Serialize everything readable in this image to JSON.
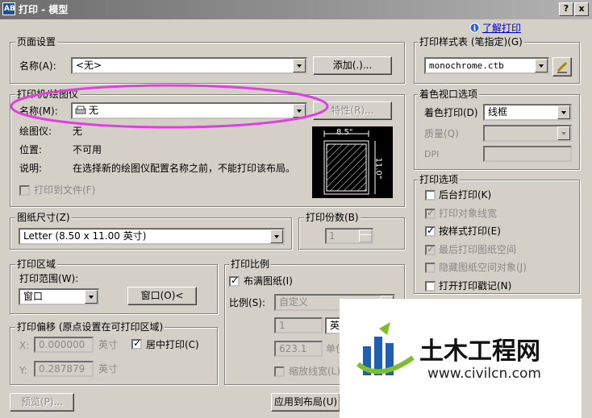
{
  "window": {
    "title": "打印 - 模型",
    "app_icon_text": "AB",
    "help_btn": "?",
    "close_btn": "x",
    "learn_link": "了解打印"
  },
  "page_setup": {
    "legend": "页面设置",
    "name_label": "名称(A):",
    "name_value": "<无>",
    "add_button": "添加(.)..."
  },
  "plotter": {
    "legend": "打印机/绘图仪",
    "name_label": "名称(M):",
    "name_value": "无",
    "properties_button": "特性(R)...",
    "plotter_label": "绘图仪:",
    "plotter_value": "无",
    "location_label": "位置:",
    "location_value": "不可用",
    "description_label": "说明:",
    "description_value": "在选择新的绘图仪配置名称之前，不能打印该布局。",
    "print_to_file": "打印到文件(F)",
    "preview_width": "8.5\"",
    "preview_height": "11.0\""
  },
  "paper_size": {
    "legend": "图纸尺寸(Z)",
    "value": "Letter (8.50 x 11.00 英寸)"
  },
  "copies": {
    "legend": "打印份数(B)",
    "value": "1"
  },
  "plot_area": {
    "legend": "打印区域",
    "range_label": "打印范围(W):",
    "range_value": "窗口",
    "window_button": "窗口(O)<"
  },
  "plot_offset": {
    "legend": "打印偏移 (原点设置在可打印区域)",
    "x_label": "X:",
    "x_value": "0.000000",
    "x_unit": "英寸",
    "y_label": "Y:",
    "y_value": "0.287879",
    "y_unit": "英寸",
    "center": "居中打印(C)"
  },
  "plot_scale": {
    "legend": "打印比例",
    "fit": "布满图纸(I)",
    "scale_label": "比例(S):",
    "scale_value": "自定义",
    "value1": "1",
    "unit1": "英寸",
    "value2": "623.1",
    "unit2": "单位",
    "scale_lineweights": "缩放线宽(L)"
  },
  "buttons": {
    "preview": "预览(P)...",
    "apply": "应用到布局(U)"
  },
  "style_table": {
    "legend": "打印样式表 (笔指定)(G)",
    "value": "monochrome.ctb"
  },
  "shaded": {
    "legend": "着色视口选项",
    "shade_label": "着色打印(D)",
    "shade_value": "线框",
    "quality_label": "质量(Q)",
    "dpi_label": "DPI"
  },
  "options": {
    "legend": "打印选项",
    "items": [
      {
        "label": "后台打印(K)",
        "checked": false,
        "disabled": false
      },
      {
        "label": "打印对象线宽",
        "checked": true,
        "disabled": true
      },
      {
        "label": "按样式打印(E)",
        "checked": true,
        "disabled": false
      },
      {
        "label": "最后打印图纸空间",
        "checked": true,
        "disabled": true
      },
      {
        "label": "隐藏图纸空间对象(J)",
        "checked": false,
        "disabled": true
      },
      {
        "label": "打开打印戳记(N)",
        "checked": false,
        "disabled": false
      }
    ]
  },
  "watermark": {
    "name": "土木工程网",
    "url": "www.civilcn.com"
  },
  "colors": {
    "annotation_ellipse": "#e040e0",
    "watermark_blue": "#1e5fb4",
    "watermark_green": "#7cbf2a"
  }
}
